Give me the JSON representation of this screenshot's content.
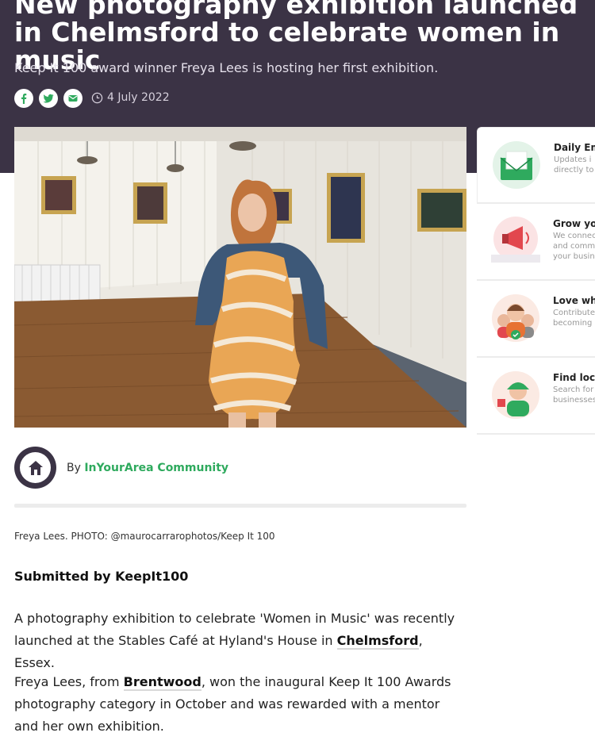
{
  "article": {
    "title": "New photography exhibition launched in Chelmsford to celebrate women in music",
    "subtitle": "Keep It 100 award winner Freya Lees is hosting her first exhibition.",
    "date": "4 July 2022",
    "share_icons": [
      "facebook-icon",
      "twitter-icon",
      "email-icon"
    ],
    "author_prefix": "By",
    "author_name": "InYourArea Community",
    "photo_caption": "Freya Lees. PHOTO: @maurocarrarophotos/Keep It 100",
    "submitted_by": "Submitted by KeepIt100",
    "paragraph1": {
      "before": "A photography exhibition to celebrate 'Women in Music' was recently launched at the Stables Café at Hyland's House in ",
      "link": "Chelmsford",
      "after": ", Essex."
    },
    "paragraph2": {
      "before": "Freya Lees, from ",
      "link": "Brentwood",
      "after": ", won the inaugural Keep It 100 Awards photography category in October and was rewarded with a mentor and her own exhibition."
    }
  },
  "sidebar": {
    "cards": [
      {
        "title": "Daily Em",
        "lines": [
          "Updates i",
          "directly to"
        ],
        "icon": "envelope-icon"
      },
      {
        "title": "Grow you",
        "lines": [
          "We connec",
          "and comm",
          "your busin"
        ],
        "icon": "megaphone-icon"
      },
      {
        "title": "Love whe",
        "lines": [
          "Contribute",
          "becoming a"
        ],
        "icon": "community-icon"
      },
      {
        "title": "Find loca",
        "lines": [
          "Search for",
          "businesses"
        ],
        "icon": "shopkeeper-icon"
      }
    ]
  },
  "colors": {
    "header_bg": "#3b3345",
    "accent_green": "#2faa5e"
  }
}
